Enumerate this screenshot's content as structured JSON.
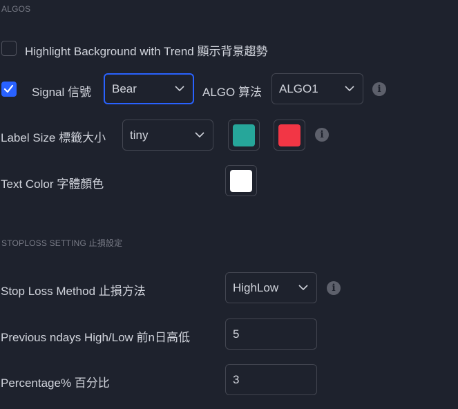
{
  "sections": {
    "algos": "ALGOS",
    "stoploss": "STOPLOSS SETTING 止損設定"
  },
  "highlight": {
    "label": "Highlight Background with Trend 顯示背景趨勢",
    "checked": false
  },
  "signal": {
    "label": "Signal 信號",
    "checked": true,
    "value": "Bear",
    "algo_label": "ALGO 算法",
    "algo_value": "ALGO1"
  },
  "label_size": {
    "label": "Label Size 標籤大小",
    "value": "tiny",
    "bull_color": "#26a69a",
    "bear_color": "#f23645"
  },
  "text_color": {
    "label": "Text Color 字體顏色",
    "color": "#ffffff"
  },
  "stop_loss_method": {
    "label": "Stop Loss Method 止損方法",
    "value": "HighLow"
  },
  "previous_ndays": {
    "label": "Previous ndays High/Low 前n日高低",
    "value": "5"
  },
  "percentage": {
    "label": "Percentage% 百分比",
    "value": "3"
  },
  "icons": {
    "info": "info-icon",
    "chevron": "chevron-down-icon",
    "check": "checkmark-icon"
  },
  "info_glyph": "i"
}
